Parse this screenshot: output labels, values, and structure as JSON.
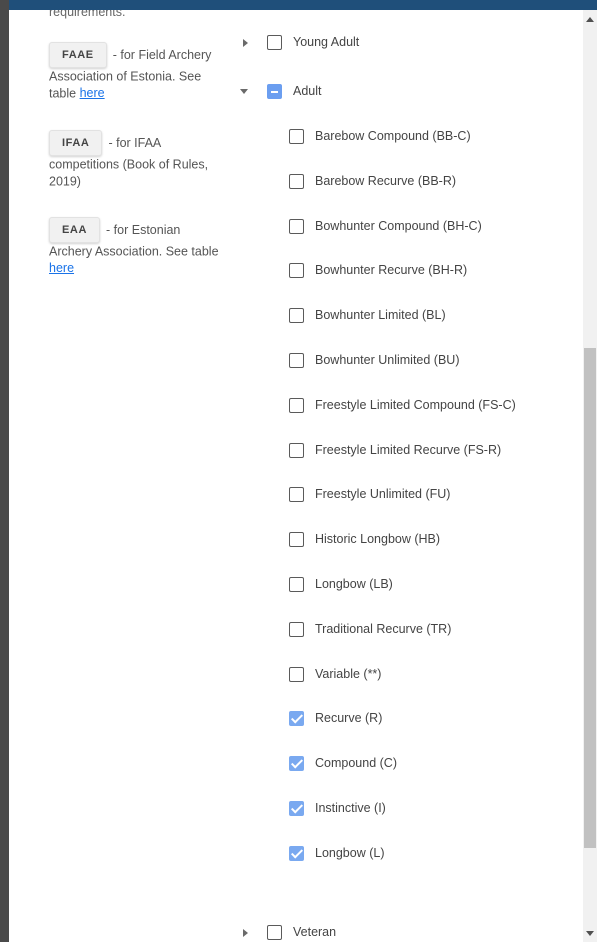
{
  "left_panel": {
    "cut_text": "requirements.",
    "infos": [
      {
        "chip": "FAAE",
        "desc": "- for Field Archery Association of Estonia. See table ",
        "link": "here"
      },
      {
        "chip": "IFAA",
        "desc": "- for IFAA competitions (Book of Rules, 2019)",
        "link": ""
      },
      {
        "chip": "EAA",
        "desc": "- for Estonian Archery Association. See table ",
        "link": "here"
      }
    ]
  },
  "tree": {
    "young_adult": {
      "label": "Young Adult",
      "state": "unchecked",
      "caret": "collapsed"
    },
    "adult": {
      "label": "Adult",
      "state": "indeterminate",
      "caret": "expanded"
    },
    "classes": [
      {
        "label": "Barebow Compound (BB-C)",
        "checked": false
      },
      {
        "label": "Barebow Recurve (BB-R)",
        "checked": false
      },
      {
        "label": "Bowhunter Compound (BH-C)",
        "checked": false
      },
      {
        "label": "Bowhunter Recurve (BH-R)",
        "checked": false
      },
      {
        "label": "Bowhunter Limited (BL)",
        "checked": false
      },
      {
        "label": "Bowhunter Unlimited (BU)",
        "checked": false
      },
      {
        "label": "Freestyle Limited Compound (FS-C)",
        "checked": false
      },
      {
        "label": "Freestyle Limited Recurve (FS-R)",
        "checked": false
      },
      {
        "label": "Freestyle Unlimited (FU)",
        "checked": false
      },
      {
        "label": "Historic Longbow (HB)",
        "checked": false
      },
      {
        "label": "Longbow (LB)",
        "checked": false
      },
      {
        "label": "Traditional Recurve (TR)",
        "checked": false
      },
      {
        "label": "Variable (**)",
        "checked": false
      },
      {
        "label": "Recurve (R)",
        "checked": true
      },
      {
        "label": "Compound (C)",
        "checked": true
      },
      {
        "label": "Instinctive (I)",
        "checked": true
      },
      {
        "label": "Longbow (L)",
        "checked": true
      }
    ],
    "veteran": {
      "label": "Veteran",
      "state": "unchecked",
      "caret": "collapsed"
    }
  }
}
